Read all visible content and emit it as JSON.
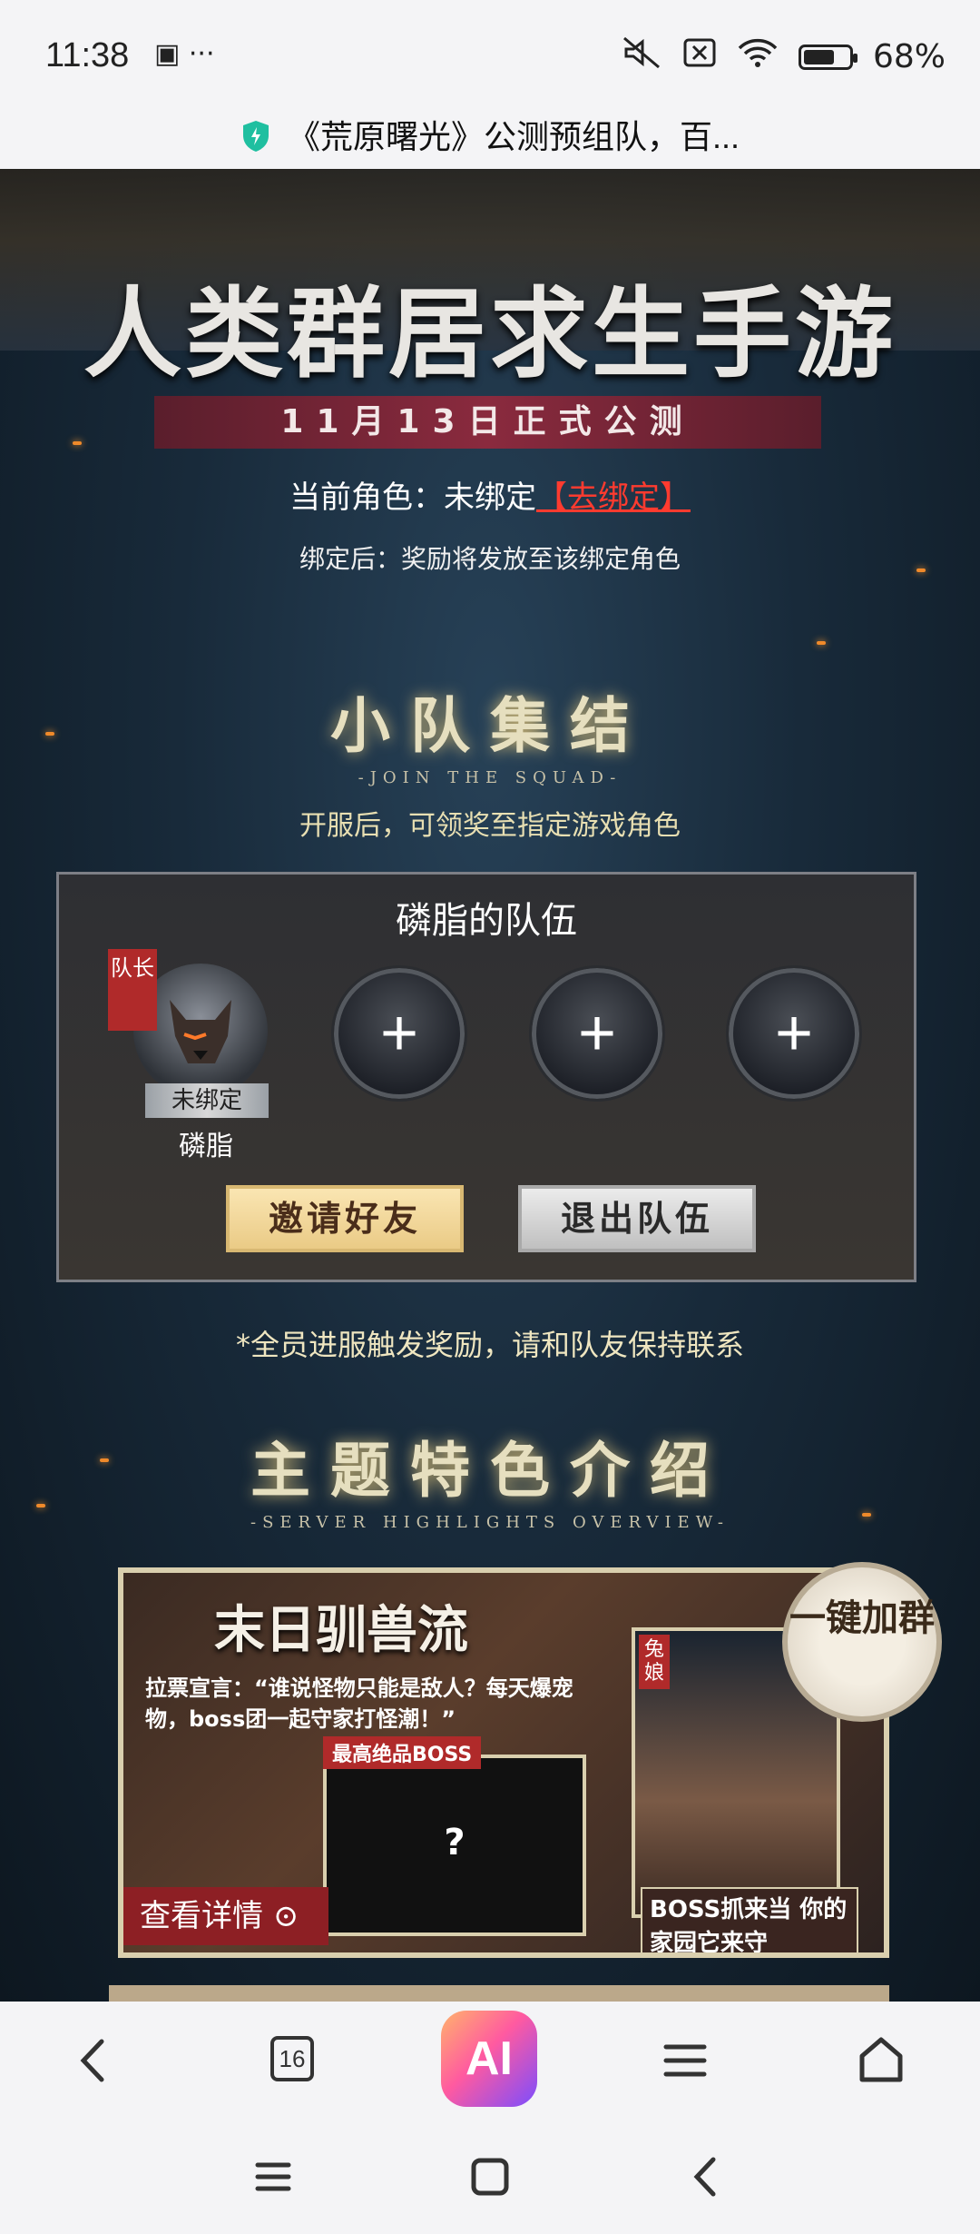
{
  "status_bar": {
    "time": "11:38",
    "battery": "68%",
    "battery_level": 0.68
  },
  "address_bar": {
    "title": "《荒原曙光》公测预组队，百..."
  },
  "hero": {
    "title": "人类群居求生手游",
    "date_banner": "11月13日正式公测",
    "role_label": "当前角色：未绑定",
    "bind_link": "【去绑定】",
    "bind_hint": "绑定后：奖励将发放至该绑定角色"
  },
  "squad_section": {
    "title": "小队集结",
    "subtitle": "-JOIN THE SQUAD-",
    "desc": "开服后，可领奖至指定游戏角色",
    "team_name": "磷脂的队伍",
    "captain_tag": "队长",
    "member_status": "未绑定",
    "member_name": "磷脂",
    "empty_slot": "+",
    "invite_label": "邀请好友",
    "leave_label": "退出队伍",
    "footnote": "*全员进服触发奖励，请和队友保持联系"
  },
  "feature_section": {
    "title": "主题特色介绍",
    "subtitle": "-SERVER HIGHLIGHTS OVERVIEW-",
    "banner_title": "末日驯兽流",
    "quote": "拉票宣言：“谁说怪物只能是敌人？每天爆宠物，boss团一起守家打怪潮！”",
    "boss_tag": "最高绝品BOSS",
    "boss_mark": "?",
    "rabbit_tag": "兔娘",
    "details_label": "查看详情",
    "boss_caption": "BOSS抓来当 你的家园它来守",
    "join_group_label": "一键加群"
  },
  "browser_bar": {
    "tab_count": "16",
    "ai_label": "AI"
  },
  "colors": {
    "accent_red": "#ff3b2f",
    "gold": "#e9c983",
    "banner_red": "#8a2a3e"
  }
}
